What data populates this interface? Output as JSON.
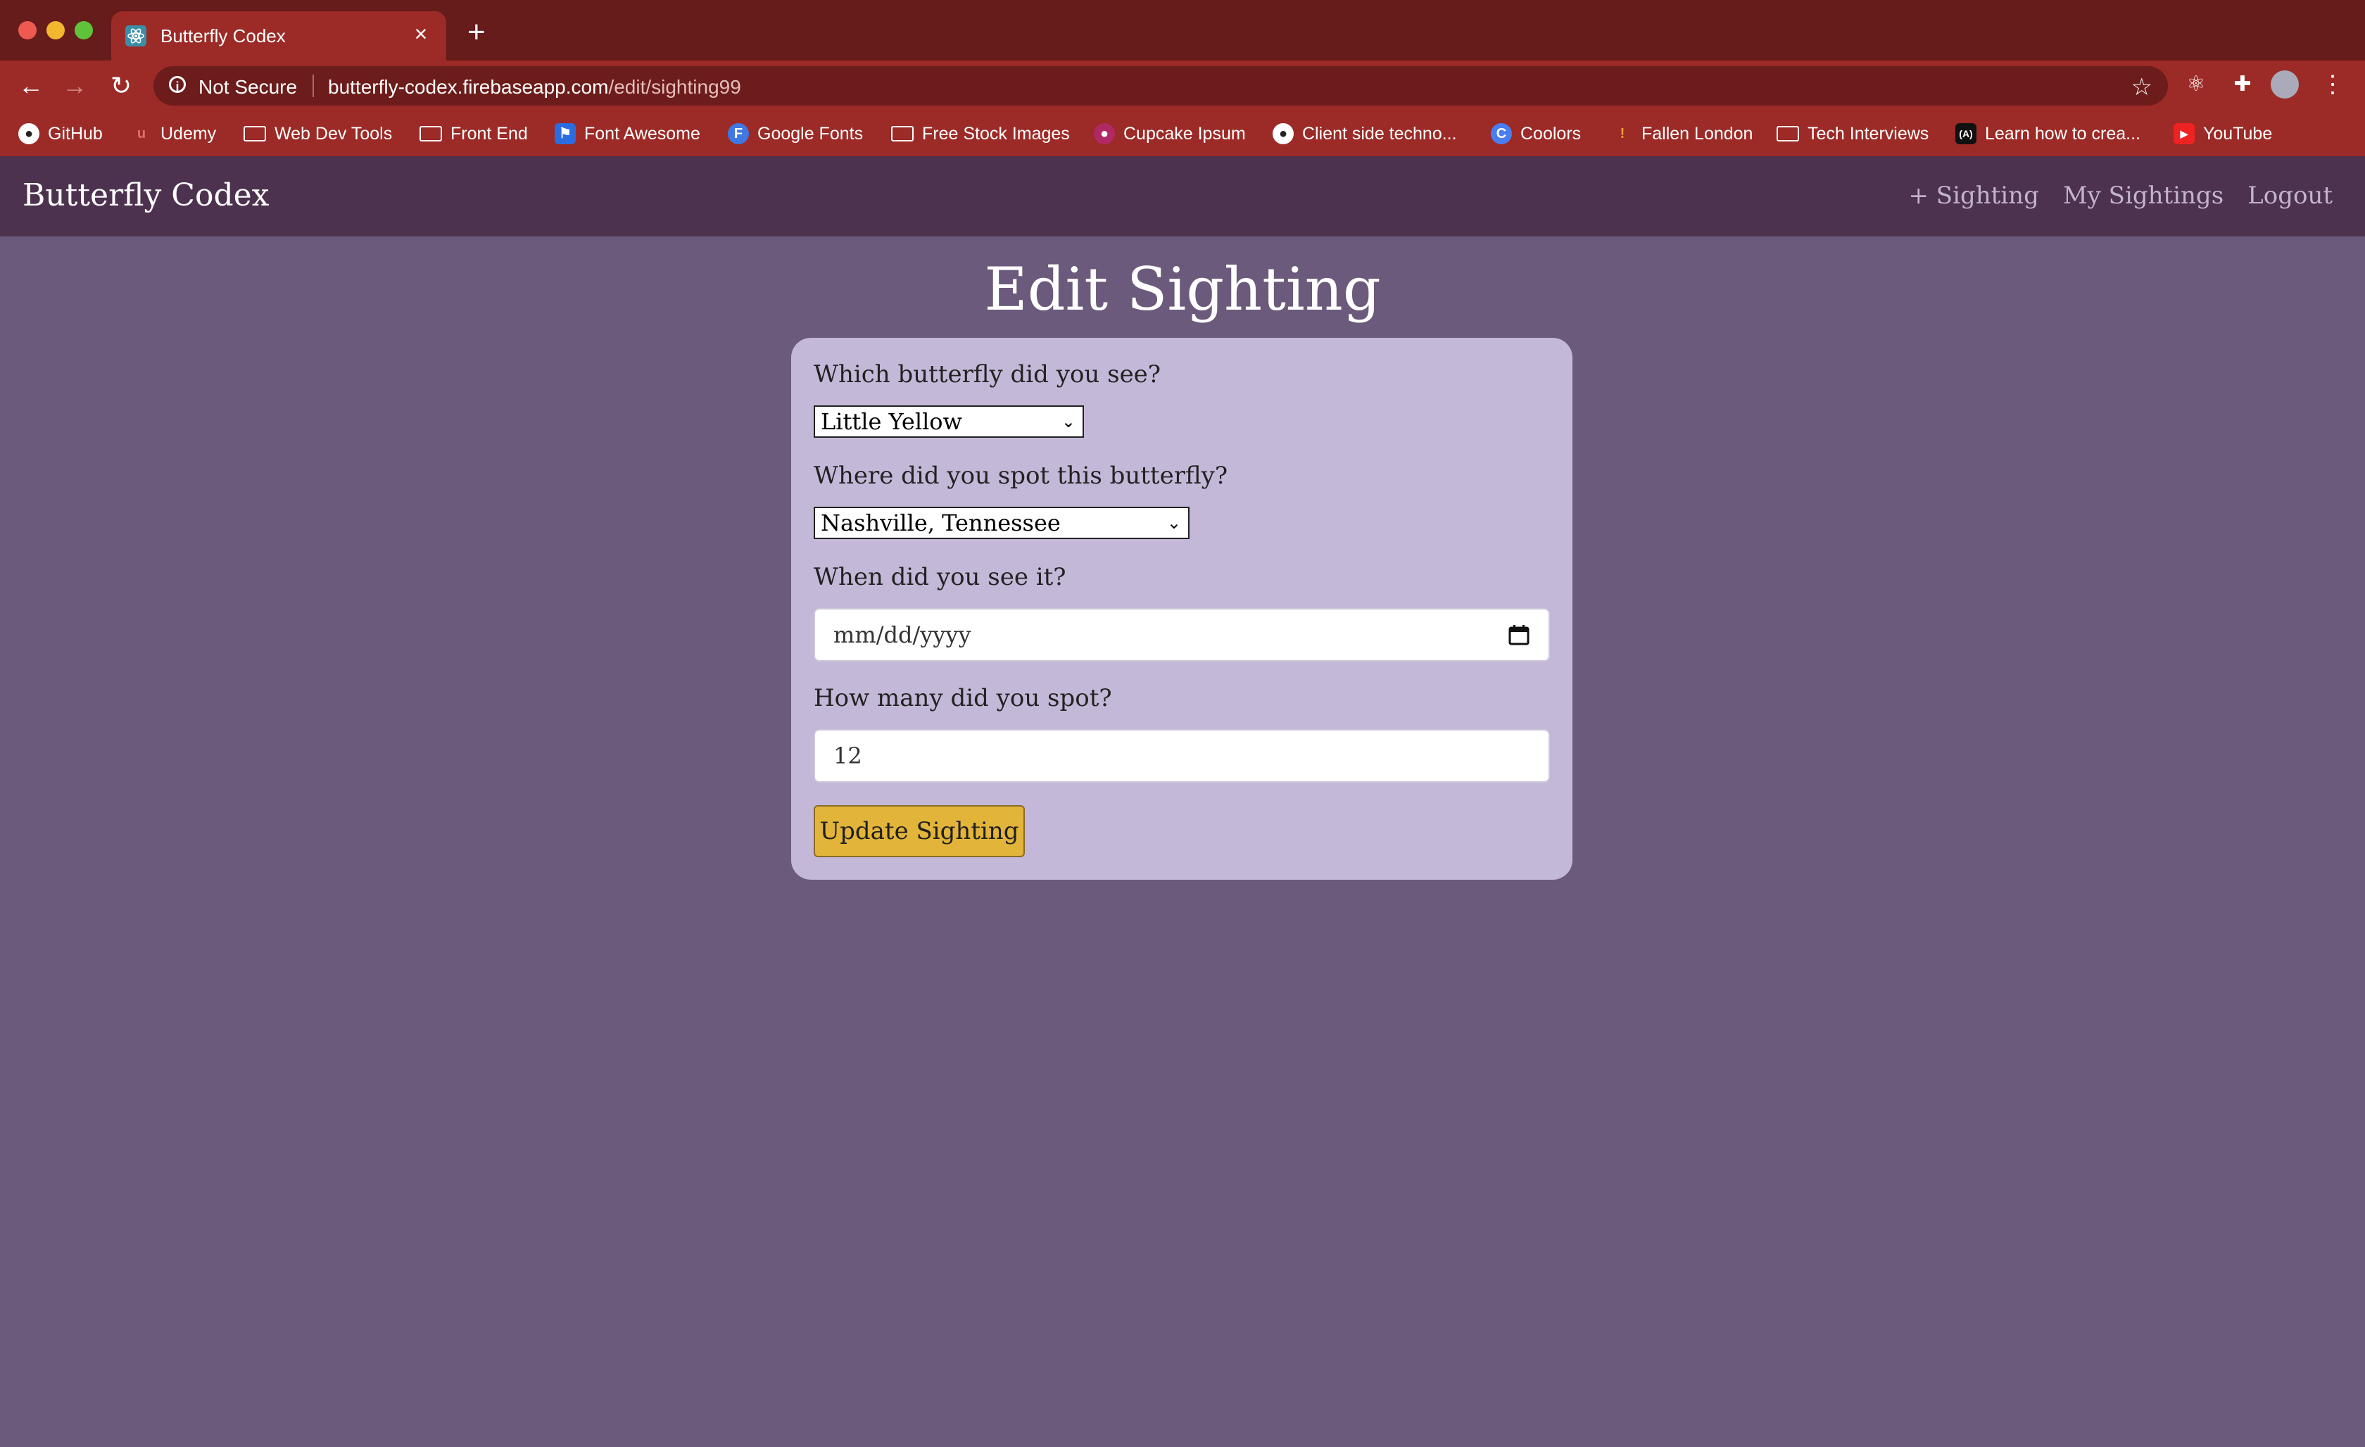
{
  "browser": {
    "tab_title": "Butterfly Codex",
    "tab_close": "×",
    "new_tab": "+",
    "security_label": "Not Secure",
    "url_host": "butterfly-codex.firebaseapp.com",
    "url_path": "/edit/sighting99",
    "bookmarks": [
      {
        "label": "GitHub",
        "icon": "github-icon"
      },
      {
        "label": "Udemy",
        "icon": "udemy-icon"
      },
      {
        "label": "Web Dev Tools",
        "icon": "folder-icon"
      },
      {
        "label": "Front End",
        "icon": "folder-icon"
      },
      {
        "label": "Font Awesome",
        "icon": "flag-icon"
      },
      {
        "label": "Google Fonts",
        "icon": "google-fonts-icon"
      },
      {
        "label": "Free Stock Images",
        "icon": "folder-icon"
      },
      {
        "label": "Cupcake Ipsum",
        "icon": "cupcake-icon"
      },
      {
        "label": "Client side techno...",
        "icon": "github-icon"
      },
      {
        "label": "Coolors",
        "icon": "coolors-icon"
      },
      {
        "label": "Fallen London",
        "icon": "candle-icon"
      },
      {
        "label": "Tech Interviews",
        "icon": "folder-icon"
      },
      {
        "label": "Learn how to crea...",
        "icon": "code-icon"
      },
      {
        "label": "YouTube",
        "icon": "youtube-icon"
      }
    ]
  },
  "app": {
    "brand": "Butterfly Codex",
    "nav": {
      "add_sighting": "+ Sighting",
      "my_sightings": "My Sightings",
      "logout": "Logout"
    },
    "page_title": "Edit Sighting",
    "form": {
      "butterfly_label": "Which butterfly did you see?",
      "butterfly_value": "Little Yellow",
      "location_label": "Where did you spot this butterfly?",
      "location_value": "Nashville, Tennessee",
      "date_label": "When did you see it?",
      "date_placeholder": "mm/dd/yyyy",
      "count_label": "How many did you spot?",
      "count_value": "12",
      "submit_label": "Update Sighting"
    }
  },
  "colors": {
    "page_bg": "#6b5a7b",
    "appbar_bg": "#4c324f",
    "card_bg": "#c4b8d8",
    "button_bg": "#e2b43a"
  }
}
